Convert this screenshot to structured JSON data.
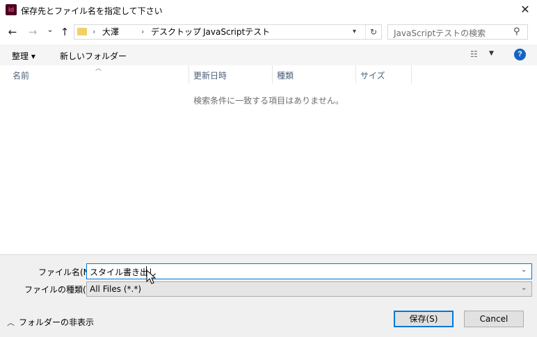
{
  "window": {
    "title": "保存先とファイル名を指定して下さい",
    "app_icon_text": "Id",
    "close_glyph": "✕"
  },
  "nav": {
    "back_glyph": "←",
    "forward_glyph": "→",
    "recent_glyph": "⌄",
    "up_glyph": "↑",
    "breadcrumb": [
      "大澤",
      "デスクトップ",
      "JavaScriptテスト"
    ],
    "breadcrumb_sep": "›",
    "refresh_glyph": "↻",
    "search_placeholder": "JavaScriptテストの検索"
  },
  "toolbar": {
    "organize_label": "整理 ▾",
    "new_folder_label": "新しいフォルダー",
    "view_glyph": "☷",
    "help_label": "?"
  },
  "columns": {
    "name": "名前",
    "modified": "更新日時",
    "type": "種類",
    "size": "サイズ"
  },
  "file_list": {
    "empty_message": "検索条件に一致する項目はありません。"
  },
  "form": {
    "filename_label": "ファイル名(N):",
    "filename_value": "スタイル書き出し",
    "filetype_label": "ファイルの種類(T):",
    "filetype_value": "All Files (*.*)"
  },
  "footer": {
    "hide_folders_label": "フォルダーの非表示",
    "save_label": "保存(S)",
    "cancel_label": "Cancel"
  },
  "colors": {
    "accent": "#0078d7",
    "help_icon": "#1565c0",
    "folder": "#f2cf67",
    "bottom_panel": "#f0f0f0"
  }
}
